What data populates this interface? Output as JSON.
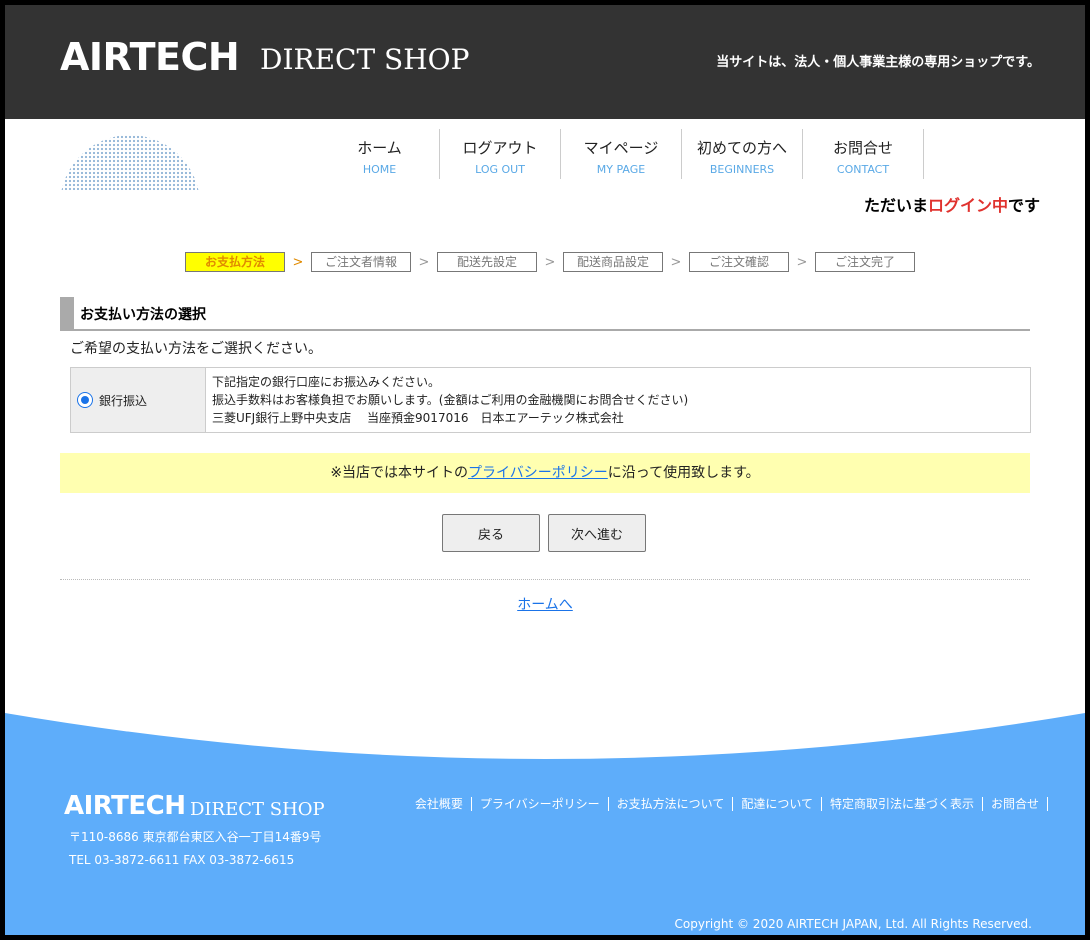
{
  "header": {
    "logo_main": "AIRTECH",
    "logo_sub": "DIRECT SHOP",
    "tagline": "当サイトは、法人・個人事業主様の専用ショップです。"
  },
  "nav": [
    {
      "jp": "ホーム",
      "en": "HOME"
    },
    {
      "jp": "ログアウト",
      "en": "LOG OUT"
    },
    {
      "jp": "マイページ",
      "en": "MY PAGE"
    },
    {
      "jp": "初めての方へ",
      "en": "BEGINNERS"
    },
    {
      "jp": "お問合せ",
      "en": "CONTACT"
    }
  ],
  "login_status": {
    "prefix": "ただいま",
    "highlight": "ログイン中",
    "suffix": "です"
  },
  "steps": [
    "お支払方法",
    "ご注文者情報",
    "配送先設定",
    "配送商品設定",
    "ご注文確認",
    "ご注文完了"
  ],
  "step_arrow": ">",
  "section": {
    "title": "お支払い方法の選択",
    "lead": "ご希望の支払い方法をご選択ください。"
  },
  "payment": {
    "option_label": "銀行振込",
    "lines": [
      "下記指定の銀行口座にお振込みください。",
      "振込手数料はお客様負担でお願いします。(金額はご利用の金融機関にお問合せください)",
      "三菱UFJ銀行上野中央支店　 当座預金9017016　日本エアーテック株式会社"
    ]
  },
  "privacy": {
    "prefix": "※当店では本サイトの",
    "link": "プライバシーポリシー",
    "suffix": "に沿って使用致します。"
  },
  "buttons": {
    "back": "戻る",
    "next": "次へ進む"
  },
  "home_link": "ホームへ",
  "footer": {
    "logo_main": "AIRTECH",
    "logo_sub": "DIRECT SHOP",
    "address": "〒110-8686 東京都台東区入谷一丁目14番9号",
    "tel": "TEL 03-3872-6611 FAX 03-3872-6615",
    "links": [
      "会社概要",
      "プライバシーポリシー",
      "お支払方法について",
      "配達について",
      "特定商取引法に基づく表示",
      "お問合せ"
    ],
    "copyright": "Copyright © 2020 AIRTECH JAPAN, Ltd. All Rights Reserved."
  },
  "colors": {
    "footer_blue": "#5eadfa",
    "header_dark": "#333333",
    "accent_red": "#e0322e",
    "active_step": "#ffff00"
  }
}
